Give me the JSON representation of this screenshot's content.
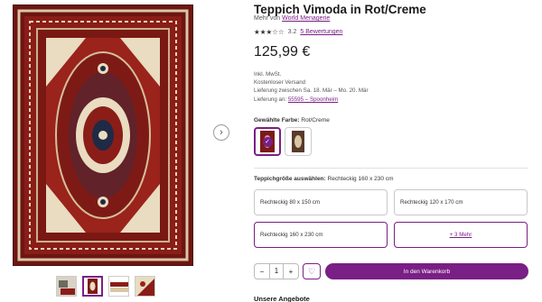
{
  "product": {
    "title": "Teppich Vimoda in Rot/Creme",
    "brand_prefix": "Mehr von",
    "brand": "World Menagerie",
    "rating_stars": "★★★☆☆",
    "rating": "3.2",
    "reviews": "5 Bewertungen",
    "price": "125,99 €"
  },
  "meta": {
    "tax": "Inkl. MwSt.",
    "shipping": "Kostenloser Versand",
    "delivery": "Lieferung zwischen Sa. 18. Mär – Mo. 20. Mär",
    "delivery_to_prefix": "Lieferung an:",
    "delivery_to": "55595 – Spoonheim"
  },
  "color": {
    "label": "Gewählte Farbe:",
    "value": "Rot/Creme"
  },
  "size": {
    "label": "Teppichgröße auswählen:",
    "value": "Rechteckig 160 x 230 cm",
    "options": [
      "Rechteckig 80 x 150 cm",
      "Rechteckig 120 x 170 cm",
      "Rechteckig 160 x 230 cm",
      "+ 3 Mehr"
    ]
  },
  "actions": {
    "qty_minus": "−",
    "qty_value": "1",
    "qty_plus": "+",
    "wishlist_icon": "heart-icon",
    "add_to_cart": "In den Warenkorb"
  },
  "offers_heading": "Unsere Angebote",
  "gallery": {
    "next_icon": "chevron-right-icon"
  },
  "colors": {
    "accent": "#7a1f85",
    "rug_red": "#7e1a16"
  }
}
